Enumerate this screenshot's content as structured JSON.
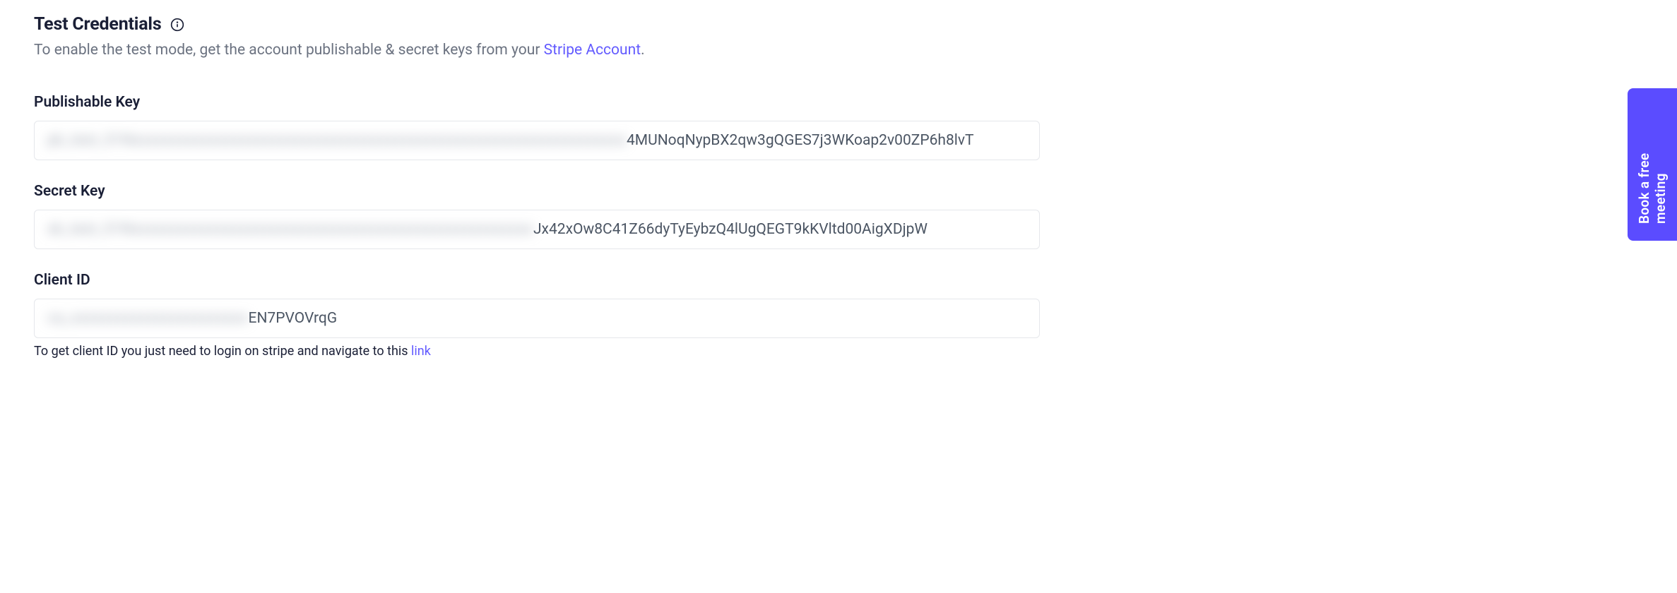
{
  "header": {
    "title": "Test Credentials",
    "subtitle_prefix": "To enable the test mode, get the account publishable & secret keys from your ",
    "subtitle_link": "Stripe Account",
    "subtitle_suffix": "."
  },
  "fields": {
    "publishable_key": {
      "label": "Publishable Key",
      "blurred": "pk_test_51Nxxxxxxxxxxxxxxxxxxxxxxxxxxxxxxxxxxxxxxxxxxxxxxxxxxxxxxxxxxxxxxxx",
      "visible": "4MUNoqNypBX2qw3gQGES7j3WKoap2v00ZP6h8lvT"
    },
    "secret_key": {
      "label": "Secret Key",
      "blurred": "sk_test_51Nxxxxxxxxxxxxxxxxxxxxxxxxxxxxxxxxxxxxxxxxxxxxxxxxxxxx",
      "visible": "Jx42xOw8C41Z66dyTyEybzQ4lUgQEGT9kKVltd00AigXDjpW"
    },
    "client_id": {
      "label": "Client ID",
      "blurred": "ca_xxxxxxxxxxxxxxxxxxxxxxx",
      "visible": "EN7PVOVrqG",
      "helper_prefix": "To get client ID you just need to login on stripe and navigate to this ",
      "helper_link": "link"
    }
  },
  "cta": {
    "label": "Book a free meeting"
  }
}
